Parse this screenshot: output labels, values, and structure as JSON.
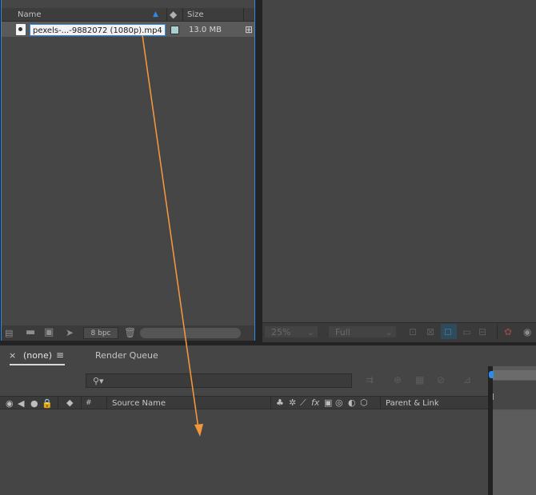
{
  "project": {
    "col_name": "Name",
    "col_size": "Size",
    "file_name": "pexels-...-9882072 (1080p).mp4",
    "file_size": "13.0 MB",
    "bpc": "8 bpc"
  },
  "viewer": {
    "zoom": "25%",
    "resolution": "Full"
  },
  "timeline": {
    "tab_close": "×",
    "tab_comp": "(none)",
    "tab_menu": "≡",
    "tab_render": "Render Queue",
    "col_hash": "#",
    "col_source": "Source Name",
    "col_parent": "Parent & Link",
    "switch_fx": "fx"
  },
  "colors": {
    "accent": "#2d8ceb",
    "arrow": "#f0963c"
  }
}
